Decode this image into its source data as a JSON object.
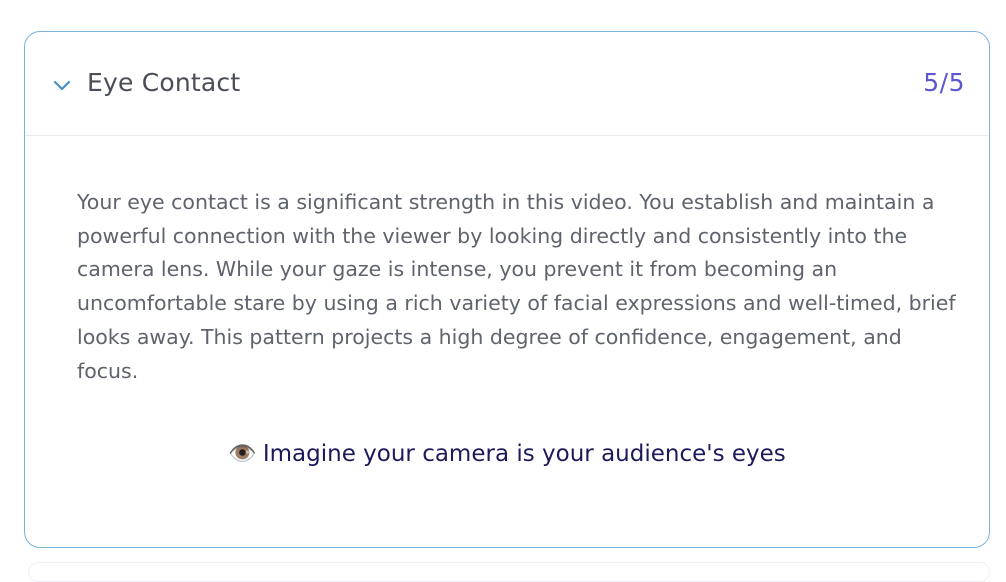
{
  "card": {
    "title": "Eye Contact",
    "score": "5/5",
    "expanded": true,
    "chevron_icon": "chevron-down-icon",
    "accent_color": "#5b57d1",
    "border_color": "#7ab3dc",
    "body": "Your eye contact is a significant strength in this video. You establish and maintain a powerful connection with the viewer by looking directly and consistently into the camera lens. While your gaze is intense, you prevent it from becoming an uncomfortable stare by using a rich variety of facial expressions and well-timed, brief looks away. This pattern projects a high degree of confidence, engagement, and focus.",
    "tip": {
      "icon": "👁️",
      "icon_name": "eye-icon",
      "text": "Imagine your camera is your audience's eyes"
    }
  }
}
